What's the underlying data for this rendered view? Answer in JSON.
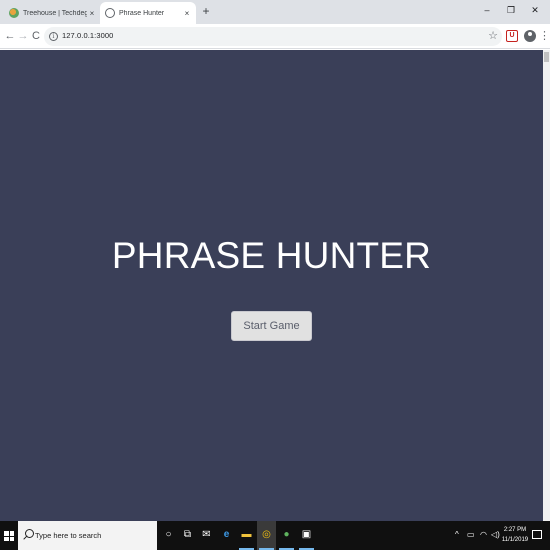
{
  "browser": {
    "tabs": [
      {
        "title": "Treehouse | Techdegree",
        "favicon": "treehouse-icon",
        "active": false
      },
      {
        "title": "Phrase Hunter",
        "favicon": "globe-icon",
        "active": true
      }
    ],
    "close_glyph": "×",
    "new_tab_glyph": "+",
    "window_controls": {
      "minimize": "–",
      "restore": "❐",
      "close": "✕"
    },
    "nav": {
      "back": "←",
      "forward": "→",
      "reload": "C"
    },
    "address": "127.0.0.1:3000",
    "info_glyph": "i",
    "star_glyph": "☆",
    "extension_glyph": "U",
    "menu_glyph": "⋮"
  },
  "page": {
    "background": "#3a3f58",
    "title": "PHRASE HUNTER",
    "start_button": "Start Game"
  },
  "taskbar": {
    "search_placeholder": "Type here to search",
    "apps": [
      {
        "name": "cortana-icon",
        "glyph": "○"
      },
      {
        "name": "task-view-icon",
        "glyph": "⧉"
      },
      {
        "name": "mail-icon",
        "glyph": "✉"
      },
      {
        "name": "edge-icon",
        "glyph": "e"
      },
      {
        "name": "file-explorer-icon",
        "glyph": "▬"
      },
      {
        "name": "chrome-icon",
        "glyph": "◎"
      },
      {
        "name": "app-icon",
        "glyph": "●"
      },
      {
        "name": "photos-icon",
        "glyph": "▣"
      }
    ],
    "tray": {
      "chevron": "^",
      "battery": "▭",
      "wifi": "◠",
      "volume": "◁)"
    },
    "clock": {
      "time": "2:27 PM",
      "date": "11/1/2019"
    }
  }
}
